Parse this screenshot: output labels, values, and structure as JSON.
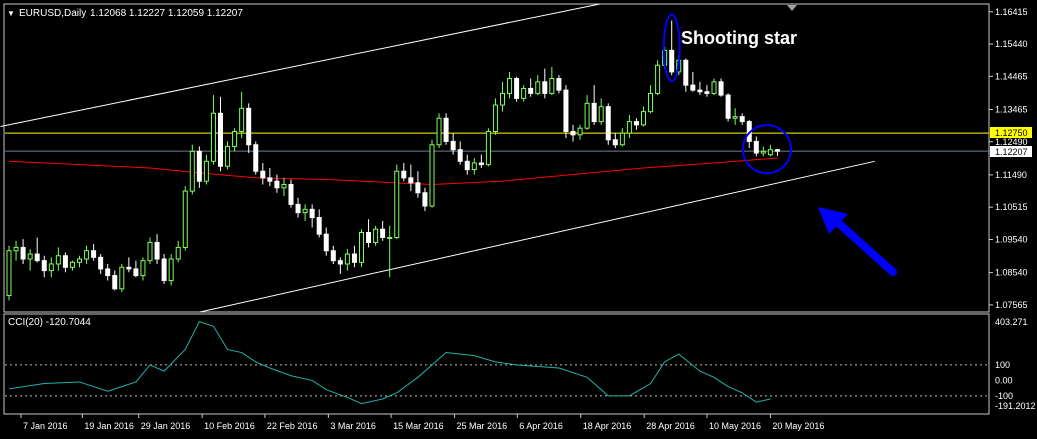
{
  "window": {
    "menu_glyph": "▼",
    "symbol": "EURUSD,Daily",
    "ohlc": "1.12068 1.12227 1.12059 1.12207"
  },
  "annotations": {
    "shooting_star": "Shooting star"
  },
  "colors": {
    "background": "#000000",
    "frame": "#c8c8c8",
    "candle_up": "#7dff5a",
    "candle_down": "#ffffff",
    "support_resistance": "#ffff00",
    "moving_average": "#ff0000",
    "channel": "#ffffff",
    "cci_line": "#20b2aa",
    "annotation_circle": "#0000ff",
    "arrow": "#0000ff",
    "current_price_label_bg": "#ffffff",
    "level_label_bg": "#ffff00"
  },
  "chart_data": [
    {
      "type": "candlestick",
      "title": "EURUSD,Daily",
      "y_ticks": [
        "1.16415",
        "1.15440",
        "1.14465",
        "1.13465",
        "1.12490",
        "1.11490",
        "1.10515",
        "1.09540",
        "1.08540",
        "1.07565"
      ],
      "y_range": [
        1.0735,
        1.1665
      ],
      "x_ticks": [
        "7 Jan 2016",
        "19 Jan 2016",
        "29 Jan 2016",
        "10 Feb 2016",
        "22 Feb 2016",
        "3 Mar 2016",
        "15 Mar 2016",
        "25 Mar 2016",
        "6 Apr 2016",
        "18 Apr 2016",
        "28 Apr 2016",
        "10 May 2016",
        "20 May 2016"
      ],
      "horizontal_level": "1.12750",
      "current_price": "1.12207",
      "ohlc": [
        [
          1.0785,
          1.0935,
          1.077,
          1.092
        ],
        [
          1.092,
          1.095,
          1.089,
          1.093
        ],
        [
          1.093,
          1.0955,
          1.088,
          1.0895
        ],
        [
          1.0895,
          1.0925,
          1.086,
          1.091
        ],
        [
          1.091,
          1.096,
          1.0885,
          1.089
        ],
        [
          1.089,
          1.0905,
          1.084,
          1.086
        ],
        [
          1.086,
          1.09,
          1.084,
          1.088
        ],
        [
          1.088,
          1.093,
          1.086,
          1.0905
        ],
        [
          1.0905,
          1.0915,
          1.0855,
          1.087
        ],
        [
          1.087,
          1.089,
          1.086,
          1.0885
        ],
        [
          1.0885,
          1.0905,
          1.087,
          1.0895
        ],
        [
          1.0895,
          1.0935,
          1.088,
          1.092
        ],
        [
          1.092,
          1.094,
          1.089,
          1.09
        ],
        [
          1.09,
          1.091,
          1.085,
          1.0865
        ],
        [
          1.0865,
          1.088,
          1.083,
          1.0845
        ],
        [
          1.0845,
          1.086,
          1.08,
          1.0805
        ],
        [
          1.0805,
          1.088,
          1.0795,
          1.087
        ],
        [
          1.087,
          1.09,
          1.0855,
          1.0865
        ],
        [
          1.0865,
          1.089,
          1.084,
          1.0845
        ],
        [
          1.0845,
          1.09,
          1.083,
          1.089
        ],
        [
          1.089,
          1.096,
          1.088,
          1.0945
        ],
        [
          1.0945,
          1.097,
          1.088,
          1.0895
        ],
        [
          1.0895,
          1.091,
          1.082,
          1.083
        ],
        [
          1.083,
          1.091,
          1.0815,
          1.0895
        ],
        [
          1.0895,
          1.095,
          1.0885,
          1.093
        ],
        [
          1.093,
          1.1115,
          1.092,
          1.11
        ],
        [
          1.11,
          1.124,
          1.109,
          1.122
        ],
        [
          1.122,
          1.1235,
          1.111,
          1.113
        ],
        [
          1.113,
          1.121,
          1.112,
          1.119
        ],
        [
          1.119,
          1.139,
          1.118,
          1.1335
        ],
        [
          1.1335,
          1.1385,
          1.116,
          1.1175
        ],
        [
          1.1175,
          1.125,
          1.1165,
          1.1235
        ],
        [
          1.1235,
          1.129,
          1.122,
          1.128
        ],
        [
          1.128,
          1.14,
          1.126,
          1.135
        ],
        [
          1.135,
          1.1365,
          1.1215,
          1.124
        ],
        [
          1.124,
          1.125,
          1.115,
          1.116
        ],
        [
          1.116,
          1.1185,
          1.112,
          1.114
        ],
        [
          1.114,
          1.117,
          1.1115,
          1.113
        ],
        [
          1.113,
          1.115,
          1.1095,
          1.111
        ],
        [
          1.111,
          1.114,
          1.1085,
          1.112
        ],
        [
          1.112,
          1.1135,
          1.105,
          1.106
        ],
        [
          1.106,
          1.108,
          1.102,
          1.1035
        ],
        [
          1.1035,
          1.106,
          1.101,
          1.1045
        ],
        [
          1.1045,
          1.106,
          1.099,
          1.102
        ],
        [
          1.102,
          1.1045,
          1.096,
          1.097
        ],
        [
          1.097,
          1.099,
          1.0905,
          1.092
        ],
        [
          1.092,
          1.0935,
          1.088,
          1.089
        ],
        [
          1.089,
          1.09,
          1.085,
          1.088
        ],
        [
          1.088,
          1.0925,
          1.086,
          1.091
        ],
        [
          1.091,
          1.0935,
          1.087,
          1.0885
        ],
        [
          1.0885,
          1.0985,
          1.087,
          1.0975
        ],
        [
          1.0975,
          1.1015,
          1.093,
          1.0945
        ],
        [
          1.0945,
          1.0995,
          1.0935,
          1.0985
        ],
        [
          1.0985,
          1.101,
          1.095,
          1.096
        ],
        [
          1.096,
          1.0995,
          1.084,
          1.096
        ],
        [
          1.096,
          1.118,
          1.0955,
          1.116
        ],
        [
          1.116,
          1.1185,
          1.113,
          1.114
        ],
        [
          1.114,
          1.118,
          1.11,
          1.1125
        ],
        [
          1.1125,
          1.116,
          1.108,
          1.1095
        ],
        [
          1.1095,
          1.111,
          1.104,
          1.1055
        ],
        [
          1.1055,
          1.1255,
          1.105,
          1.124
        ],
        [
          1.124,
          1.1335,
          1.123,
          1.132
        ],
        [
          1.132,
          1.1335,
          1.124,
          1.125
        ],
        [
          1.125,
          1.1275,
          1.121,
          1.1225
        ],
        [
          1.1225,
          1.125,
          1.118,
          1.119
        ],
        [
          1.119,
          1.121,
          1.115,
          1.1165
        ],
        [
          1.1165,
          1.12,
          1.115,
          1.1185
        ],
        [
          1.1185,
          1.121,
          1.117,
          1.118
        ],
        [
          1.118,
          1.129,
          1.1175,
          1.128
        ],
        [
          1.128,
          1.138,
          1.127,
          1.136
        ],
        [
          1.136,
          1.143,
          1.134,
          1.1395
        ],
        [
          1.1395,
          1.146,
          1.138,
          1.144
        ],
        [
          1.144,
          1.1445,
          1.137,
          1.138
        ],
        [
          1.138,
          1.142,
          1.137,
          1.141
        ],
        [
          1.141,
          1.144,
          1.1385,
          1.1395
        ],
        [
          1.1395,
          1.145,
          1.139,
          1.143
        ],
        [
          1.143,
          1.147,
          1.138,
          1.1395
        ],
        [
          1.1395,
          1.1475,
          1.139,
          1.144
        ],
        [
          1.144,
          1.145,
          1.1395,
          1.1405
        ],
        [
          1.1405,
          1.142,
          1.126,
          1.128
        ],
        [
          1.128,
          1.13,
          1.125,
          1.127
        ],
        [
          1.127,
          1.13,
          1.1255,
          1.129
        ],
        [
          1.129,
          1.139,
          1.1285,
          1.1365
        ],
        [
          1.1365,
          1.142,
          1.13,
          1.131
        ],
        [
          1.131,
          1.138,
          1.13,
          1.1355
        ],
        [
          1.1355,
          1.1365,
          1.124,
          1.1255
        ],
        [
          1.1255,
          1.1275,
          1.123,
          1.124
        ],
        [
          1.124,
          1.129,
          1.1235,
          1.1275
        ],
        [
          1.1275,
          1.133,
          1.126,
          1.131
        ],
        [
          1.131,
          1.132,
          1.1285,
          1.13
        ],
        [
          1.13,
          1.1355,
          1.1295,
          1.134
        ],
        [
          1.134,
          1.142,
          1.1335,
          1.1395
        ],
        [
          1.1395,
          1.1495,
          1.139,
          1.148
        ],
        [
          1.148,
          1.1535,
          1.147,
          1.1525
        ],
        [
          1.1525,
          1.1615,
          1.145,
          1.146
        ],
        [
          1.146,
          1.151,
          1.145,
          1.1495
        ],
        [
          1.1495,
          1.15,
          1.14,
          1.142
        ],
        [
          1.142,
          1.146,
          1.14,
          1.1405
        ],
        [
          1.1405,
          1.143,
          1.139,
          1.14
        ],
        [
          1.14,
          1.142,
          1.1385,
          1.1395
        ],
        [
          1.1395,
          1.144,
          1.139,
          1.143
        ],
        [
          1.143,
          1.144,
          1.1385,
          1.139
        ],
        [
          1.139,
          1.1395,
          1.131,
          1.132
        ],
        [
          1.132,
          1.135,
          1.13,
          1.1325
        ],
        [
          1.1325,
          1.1335,
          1.13,
          1.131
        ],
        [
          1.131,
          1.1315,
          1.123,
          1.125
        ],
        [
          1.125,
          1.1265,
          1.1205,
          1.1215
        ],
        [
          1.1215,
          1.1235,
          1.1205,
          1.122
        ],
        [
          1.121,
          1.124,
          1.1205,
          1.1225
        ],
        [
          1.1225,
          1.1228,
          1.1206,
          1.12207
        ]
      ],
      "ma_points": [
        [
          0,
          1.119
        ],
        [
          10,
          1.118
        ],
        [
          20,
          1.117
        ],
        [
          27,
          1.1155
        ],
        [
          35,
          1.114
        ],
        [
          45,
          1.1135
        ],
        [
          55,
          1.1125
        ],
        [
          60,
          1.112
        ],
        [
          70,
          1.113
        ],
        [
          80,
          1.115
        ],
        [
          90,
          1.117
        ],
        [
          100,
          1.1185
        ],
        [
          109,
          1.12
        ]
      ],
      "channel_upper": [
        [
          -1.2,
          1.1295
        ],
        [
          83.8,
          1.1665
        ]
      ],
      "channel_lower": [
        [
          27.1,
          1.0735
        ],
        [
          122.8,
          1.119
        ]
      ],
      "x_tick_indices": [
        1.7,
        10.4,
        18.4,
        27.4,
        36.3,
        45.3,
        54.2,
        63.2,
        72.1,
        81.1,
        90.1,
        99.0,
        108.0
      ],
      "annotated_candles": {
        "shooting_star_index": 94,
        "recent_cluster_indices": [
          106,
          109
        ]
      }
    },
    {
      "type": "line",
      "title": "CCI(20) -120.7044",
      "y_ticks": [
        "403.271",
        "100",
        "0.00",
        "-100",
        "-191.2012"
      ],
      "y_range": [
        -191.2012,
        403.271
      ],
      "reference_levels": [
        100,
        -100
      ],
      "x": [
        0,
        5,
        10,
        14,
        18,
        20,
        22,
        25,
        27,
        29,
        31,
        33,
        35,
        37,
        40,
        43,
        45,
        48,
        50,
        53,
        55,
        58,
        62,
        66,
        69,
        72,
        75,
        78,
        82,
        85,
        88,
        91,
        93,
        95,
        98,
        100,
        102,
        104,
        106,
        108
      ],
      "values": [
        -55,
        -20,
        -10,
        -70,
        -10,
        100,
        60,
        200,
        380,
        350,
        200,
        180,
        120,
        80,
        30,
        0,
        -60,
        -110,
        -150,
        -120,
        -80,
        20,
        180,
        160,
        120,
        100,
        90,
        80,
        20,
        -100,
        -100,
        -20,
        120,
        170,
        60,
        20,
        -40,
        -80,
        -140,
        -120
      ]
    }
  ]
}
